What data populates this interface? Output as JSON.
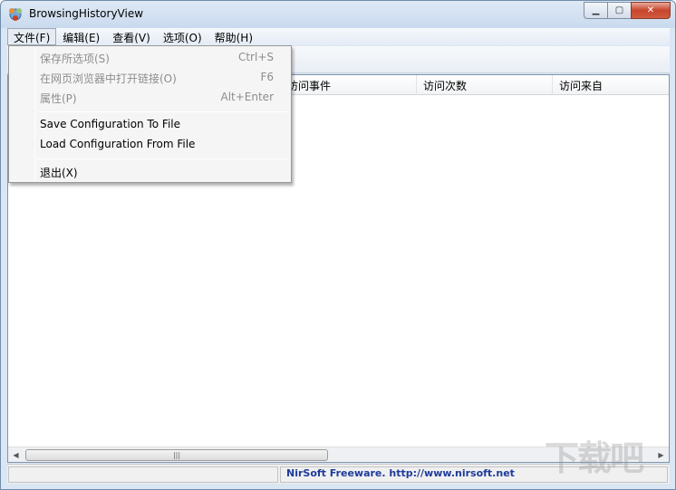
{
  "window": {
    "title": "BrowsingHistoryView"
  },
  "menubar": {
    "items": [
      {
        "label": "文件(F)"
      },
      {
        "label": "编辑(E)"
      },
      {
        "label": "查看(V)"
      },
      {
        "label": "选项(O)"
      },
      {
        "label": "帮助(H)"
      }
    ]
  },
  "columns": [
    "访问事件",
    "访问次数",
    "访问来自"
  ],
  "file_menu": {
    "items": [
      {
        "label": "保存所选项(S)",
        "shortcut": "Ctrl+S",
        "enabled": false
      },
      {
        "label": "在网页浏览器中打开链接(O)",
        "shortcut": "F6",
        "enabled": false
      },
      {
        "label": "属性(P)",
        "shortcut": "Alt+Enter",
        "enabled": false
      },
      {
        "label": "Save Configuration To File",
        "shortcut": "",
        "enabled": true
      },
      {
        "label": "Load Configuration From File",
        "shortcut": "",
        "enabled": true
      },
      {
        "label": "退出(X)",
        "shortcut": "",
        "enabled": true
      }
    ]
  },
  "statusbar": {
    "text": "NirSoft Freeware.  http://www.nirsoft.net"
  },
  "colors": {
    "link": "#1e3b9a",
    "disabled_text": "#8d8d8d",
    "close_button": "#c7452c"
  }
}
